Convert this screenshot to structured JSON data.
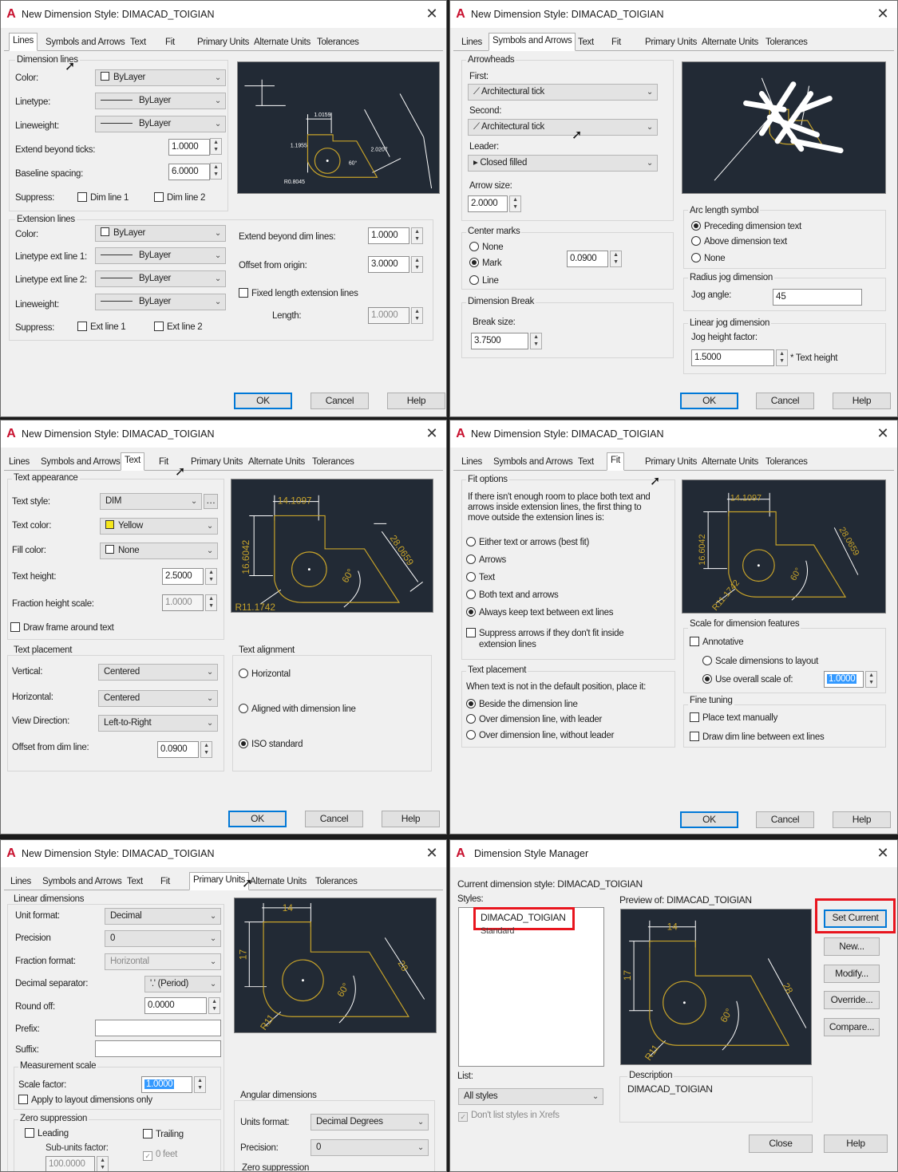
{
  "dlg_title": "New Dimension Style: DIMACAD_TOIGIAN",
  "close": "✕",
  "app_logo": "A",
  "tabs": [
    "Lines",
    "Symbols and Arrows",
    "Text",
    "Fit",
    "Primary Units",
    "Alternate Units",
    "Tolerances"
  ],
  "buttons": {
    "ok": "OK",
    "cancel": "Cancel",
    "help": "Help"
  },
  "lines": {
    "dim_group": "Dimension lines",
    "color_lbl": "Color:",
    "color_val": "ByLayer",
    "linetype_lbl": "Linetype:",
    "linetype_val": "ByLayer",
    "lineweight_lbl": "Lineweight:",
    "lineweight_val": "ByLayer",
    "extend_lbl": "Extend beyond ticks:",
    "extend_val": "1.0000",
    "baseline_lbl": "Baseline spacing:",
    "baseline_val": "6.0000",
    "suppress_lbl": "Suppress:",
    "dimline1": "Dim line 1",
    "dimline2": "Dim line 2",
    "ext_group": "Extension lines",
    "ext_color_lbl": "Color:",
    "ext_color_val": "ByLayer",
    "lt1_lbl": "Linetype ext line 1:",
    "lt1_val": "ByLayer",
    "lt2_lbl": "Linetype ext line 2:",
    "lt2_val": "ByLayer",
    "ext_lw_lbl": "Lineweight:",
    "ext_lw_val": "ByLayer",
    "ext_suppress_lbl": "Suppress:",
    "extline1": "Ext line 1",
    "extline2": "Ext line 2",
    "extend_dim_lbl": "Extend beyond dim lines:",
    "extend_dim_val": "1.0000",
    "offset_lbl": "Offset from origin:",
    "offset_val": "3.0000",
    "fixed_lbl": "Fixed length extension lines",
    "length_lbl": "Length:",
    "length_val": "1.0000",
    "preview_texts": [
      "1.0159",
      "1.1955",
      "2.0207",
      "60°",
      "R0.8045"
    ]
  },
  "sym": {
    "arrowheads": "Arrowheads",
    "first_lbl": "First:",
    "first_val": "Architectural tick",
    "second_lbl": "Second:",
    "second_val": "Architectural tick",
    "leader_lbl": "Leader:",
    "leader_val": "Closed filled",
    "arrowsize_lbl": "Arrow size:",
    "arrowsize_val": "2.0000",
    "center_group": "Center marks",
    "none": "None",
    "mark": "Mark",
    "line": "Line",
    "mark_val": "0.0900",
    "break_group": "Dimension Break",
    "break_lbl": "Break size:",
    "break_val": "3.7500",
    "arc_group": "Arc length symbol",
    "preceding": "Preceding dimension text",
    "above": "Above dimension text",
    "arc_none": "None",
    "radius_group": "Radius jog dimension",
    "jog_lbl": "Jog angle:",
    "jog_val": "45",
    "linear_group": "Linear jog dimension",
    "jogh_lbl": "Jog height factor:",
    "jogh_val": "1.5000",
    "text_height": "* Text height"
  },
  "text": {
    "appearance": "Text appearance",
    "style_lbl": "Text style:",
    "style_val": "DIM",
    "color_lbl": "Text color:",
    "color_val": "Yellow",
    "fill_lbl": "Fill color:",
    "fill_val": "None",
    "height_lbl": "Text height:",
    "height_val": "2.5000",
    "frac_lbl": "Fraction height scale:",
    "frac_val": "1.0000",
    "frame_lbl": "Draw frame around text",
    "placement": "Text placement",
    "vert_lbl": "Vertical:",
    "vert_val": "Centered",
    "horiz_lbl": "Horizontal:",
    "horiz_val": "Centered",
    "view_lbl": "View Direction:",
    "view_val": "Left-to-Right",
    "offset_lbl": "Offset from dim line:",
    "offset_val": "0.0900",
    "align_group": "Text alignment",
    "horizontal": "Horizontal",
    "aligned": "Aligned with dimension line",
    "iso": "ISO standard",
    "preview_texts": [
      "14.1097",
      "16.6042",
      "28.0659",
      "60°",
      "R11.1742"
    ]
  },
  "fit": {
    "options": "Fit options",
    "desc": "If there isn't enough room to place both text and arrows inside extension lines, the first thing to move outside the extension lines is:",
    "either": "Either text or arrows (best fit)",
    "arrows": "Arrows",
    "text": "Text",
    "both": "Both text and arrows",
    "always": "Always keep text between ext lines",
    "suppress": "Suppress arrows if they don't fit inside extension lines",
    "placement": "Text placement",
    "placement_desc": "When text is not in the default position, place it:",
    "beside": "Beside the dimension line",
    "over_leader": "Over dimension line, with leader",
    "over_no": "Over dimension line, without leader",
    "scale_group": "Scale for dimension features",
    "annotative": "Annotative",
    "layout": "Scale dimensions to layout",
    "overall": "Use overall scale of:",
    "overall_val": "1.0000",
    "fine_group": "Fine tuning",
    "manual": "Place text manually",
    "draw_dim": "Draw dim line between ext lines",
    "preview_texts": [
      "14.1097",
      "16.6042",
      "28.0659",
      "60°",
      "R11.1742"
    ]
  },
  "units": {
    "linear": "Linear dimensions",
    "format_lbl": "Unit format:",
    "format_val": "Decimal",
    "prec_lbl": "Precision",
    "prec_val": "0",
    "frac_lbl": "Fraction format:",
    "frac_val": "Horizontal",
    "sep_lbl": "Decimal separator:",
    "sep_val": "'.' (Period)",
    "round_lbl": "Round off:",
    "round_val": "0.0000",
    "prefix_lbl": "Prefix:",
    "suffix_lbl": "Suffix:",
    "meas_group": "Measurement scale",
    "scale_lbl": "Scale factor:",
    "scale_val": "1.0000",
    "apply_lbl": "Apply to layout dimensions only",
    "zero_group": "Zero suppression",
    "leading": "Leading",
    "trailing": "Trailing",
    "subunits_lbl": "Sub-units factor:",
    "subunits_val": "100.0000",
    "zero_feet": "0 feet",
    "ang_group": "Angular dimensions",
    "ang_format_lbl": "Units format:",
    "ang_format_val": "Decimal Degrees",
    "ang_prec_lbl": "Precision:",
    "ang_prec_val": "0",
    "ang_zero": "Zero suppression",
    "preview_texts": [
      "14",
      "17",
      "28",
      "60°",
      "R11"
    ]
  },
  "manager": {
    "title": "Dimension Style Manager",
    "current": "Current dimension style: DIMACAD_TOIGIAN",
    "styles_lbl": "Styles:",
    "styles": [
      "DIMACAD_TOIGIAN",
      "Standard"
    ],
    "preview_lbl": "Preview of: DIMACAD_TOIGIAN",
    "set_current": "Set Current",
    "new": "New...",
    "modify": "Modify...",
    "override": "Override...",
    "compare": "Compare...",
    "list_lbl": "List:",
    "list_val": "All styles",
    "dont_list": "Don't list styles in Xrefs",
    "desc_lbl": "Description",
    "desc_val": "DIMACAD_TOIGIAN",
    "close": "Close",
    "help": "Help",
    "preview_texts": [
      "14",
      "17",
      "28",
      "60°",
      "R11"
    ]
  },
  "colors": {
    "accent": "#0078d7",
    "highlight": "#e8151e",
    "preview_bg": "#222a35",
    "geometry": "#c7a32a"
  }
}
